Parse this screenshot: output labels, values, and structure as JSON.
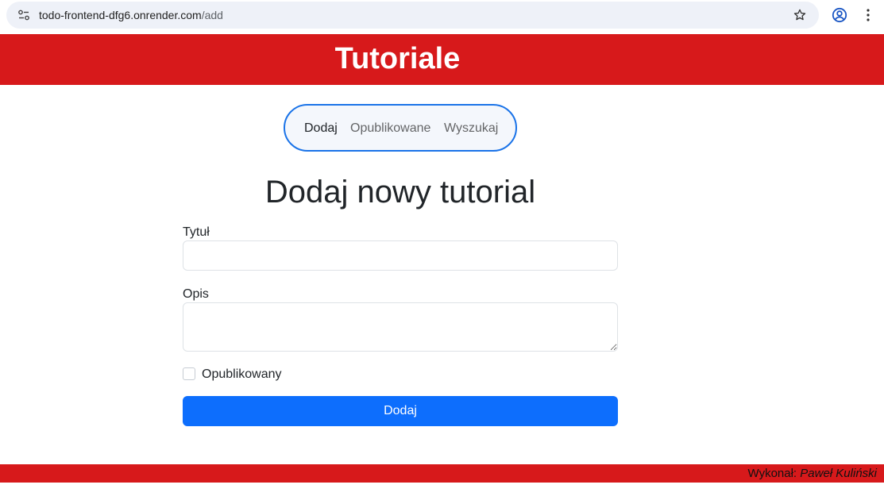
{
  "browser": {
    "url_host": "todo-frontend-dfg6.onrender.com",
    "url_path": "/add",
    "icons": [
      "site-info-icon",
      "star-icon",
      "profile-icon",
      "kebab-menu-icon"
    ]
  },
  "header": {
    "title": "Tutoriale",
    "color": "#d7191b"
  },
  "nav": {
    "items": [
      {
        "label": "Dodaj",
        "active": true
      },
      {
        "label": "Opublikowane",
        "active": false
      },
      {
        "label": "Wyszukaj",
        "active": false
      }
    ],
    "border_color": "#1a73e8"
  },
  "form": {
    "heading": "Dodaj nowy tutorial",
    "title_label": "Tytuł",
    "title_value": "",
    "description_label": "Opis",
    "description_value": "",
    "published_label": "Opublikowany",
    "published_checked": false,
    "submit_label": "Dodaj",
    "submit_color": "#0d6efd"
  },
  "footer": {
    "credit_prefix": "Wykonał:",
    "credit_name": "Paweł Kuliński"
  }
}
